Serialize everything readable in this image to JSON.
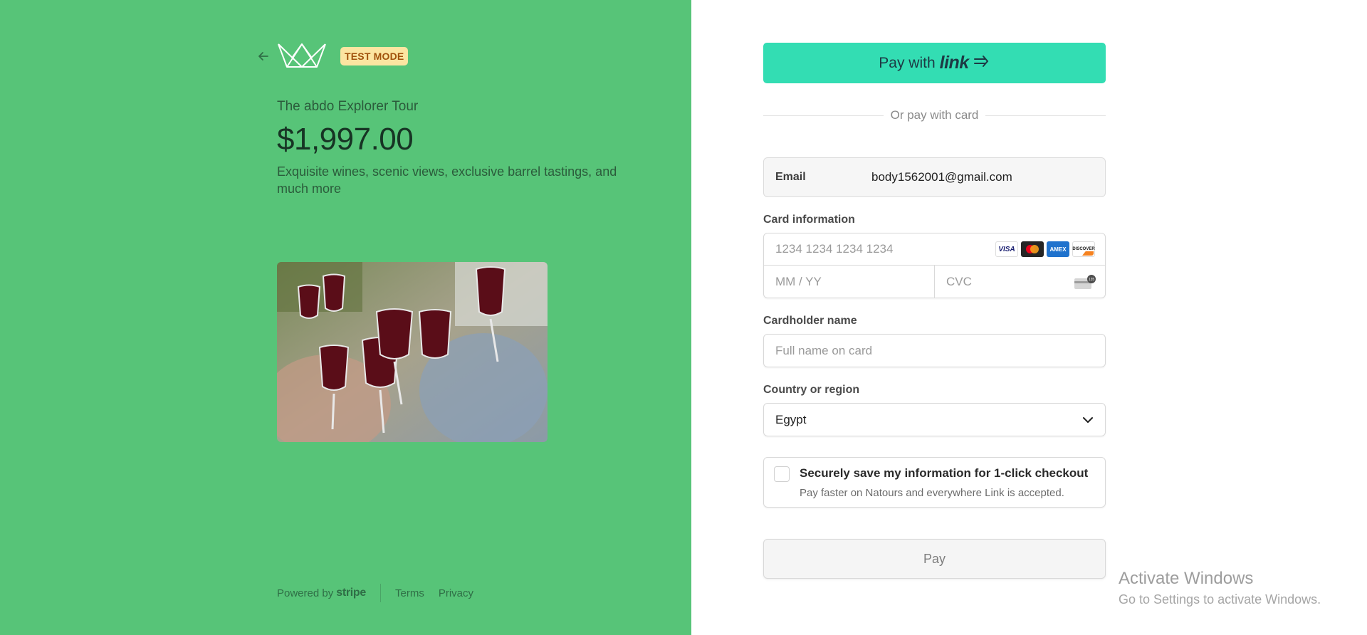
{
  "header": {
    "test_mode_badge": "TEST MODE"
  },
  "product": {
    "name": "The abdo Explorer Tour",
    "price": "$1,997.00",
    "description": "Exquisite wines, scenic views, exclusive barrel tastings, and much more"
  },
  "footer": {
    "powered_by": "Powered by",
    "stripe": "stripe",
    "terms": "Terms",
    "privacy": "Privacy"
  },
  "checkout": {
    "link_button": {
      "prefix": "Pay with",
      "brand": "link"
    },
    "divider_text": "Or pay with card",
    "email": {
      "label": "Email",
      "value": "body1562001@gmail.com"
    },
    "card_info": {
      "label": "Card information",
      "number_placeholder": "1234 1234 1234 1234",
      "expiry_placeholder": "MM / YY",
      "cvc_placeholder": "CVC",
      "brands": [
        "VISA",
        "Mastercard",
        "AMEX",
        "DISCOVER"
      ],
      "cvc_icon_text": "135"
    },
    "cardholder": {
      "label": "Cardholder name",
      "placeholder": "Full name on card"
    },
    "country": {
      "label": "Country or region",
      "value": "Egypt"
    },
    "save_info": {
      "title": "Securely save my information for 1-click checkout",
      "subtitle": "Pay faster on Natours and everywhere Link is accepted."
    },
    "pay_button": "Pay"
  },
  "watermark": {
    "title": "Activate Windows",
    "subtitle": "Go to Settings to activate Windows."
  },
  "colors": {
    "left_bg": "#57c478",
    "link_button": "#33ddb3",
    "badge_bg": "#fce5a1",
    "badge_text": "#a1520c"
  },
  "icons": [
    "back-arrow-icon",
    "crown-logo-icon",
    "link-arrow-icon",
    "chevron-down-icon",
    "cvc-card-icon"
  ]
}
